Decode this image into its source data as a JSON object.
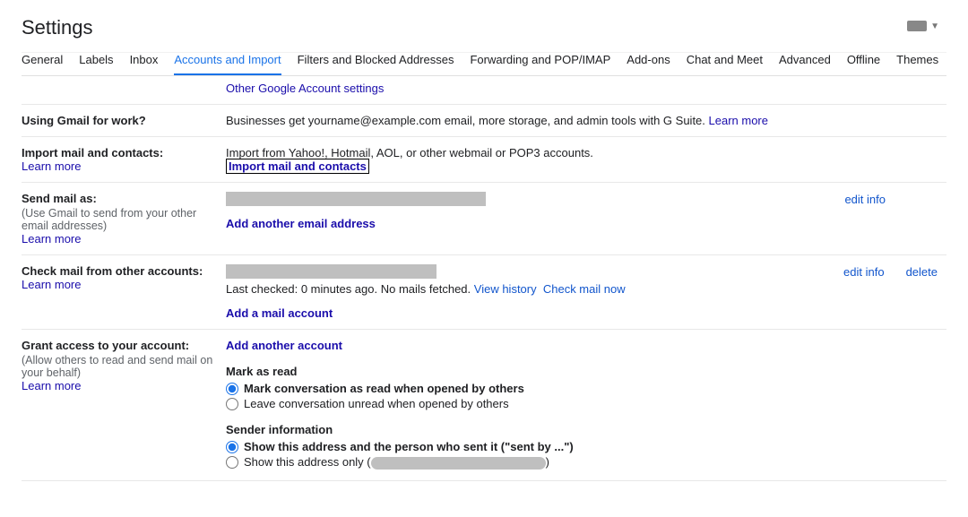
{
  "header": {
    "title": "Settings"
  },
  "tabs": {
    "general": "General",
    "labels": "Labels",
    "inbox": "Inbox",
    "accounts": "Accounts and Import",
    "filters": "Filters and Blocked Addresses",
    "forwarding": "Forwarding and POP/IMAP",
    "addons": "Add-ons",
    "chat": "Chat and Meet",
    "advanced": "Advanced",
    "offline": "Offline",
    "themes": "Themes"
  },
  "partial_top": {
    "other_settings": "Other Google Account settings"
  },
  "gmail_for_work": {
    "label": "Using Gmail for work?",
    "text": "Businesses get yourname@example.com email, more storage, and admin tools with G Suite. ",
    "learn_more": "Learn more"
  },
  "import": {
    "label": "Import mail and contacts:",
    "learn_more": "Learn more",
    "desc": "Import from Yahoo!, Hotmail, AOL, or other webmail or POP3 accounts.",
    "action": "Import mail and contacts"
  },
  "send_as": {
    "label": "Send mail as:",
    "sub": "(Use Gmail to send from your other email addresses)",
    "learn_more": "Learn more",
    "edit_info": "edit info",
    "add_another": "Add another email address"
  },
  "check_mail": {
    "label": "Check mail from other accounts:",
    "learn_more": "Learn more",
    "edit_info": "edit info",
    "delete": "delete",
    "last_checked_prefix": "Last checked: 0 minutes ago. No mails fetched. ",
    "view_history": "View history",
    "check_now": "Check mail now",
    "add_account": "Add a mail account"
  },
  "grant_access": {
    "label": "Grant access to your account:",
    "sub": "(Allow others to read and send mail on your behalf)",
    "learn_more": "Learn more",
    "add_another": "Add another account",
    "mark_read_heading": "Mark as read",
    "mark_read_opt1": "Mark conversation as read when opened by others",
    "mark_read_opt2": "Leave conversation unread when opened by others",
    "sender_heading": "Sender information",
    "sender_opt1": "Show this address and the person who sent it (\"sent by ...\")",
    "sender_opt2_pre": "Show this address only (",
    "sender_opt2_post": ")"
  }
}
